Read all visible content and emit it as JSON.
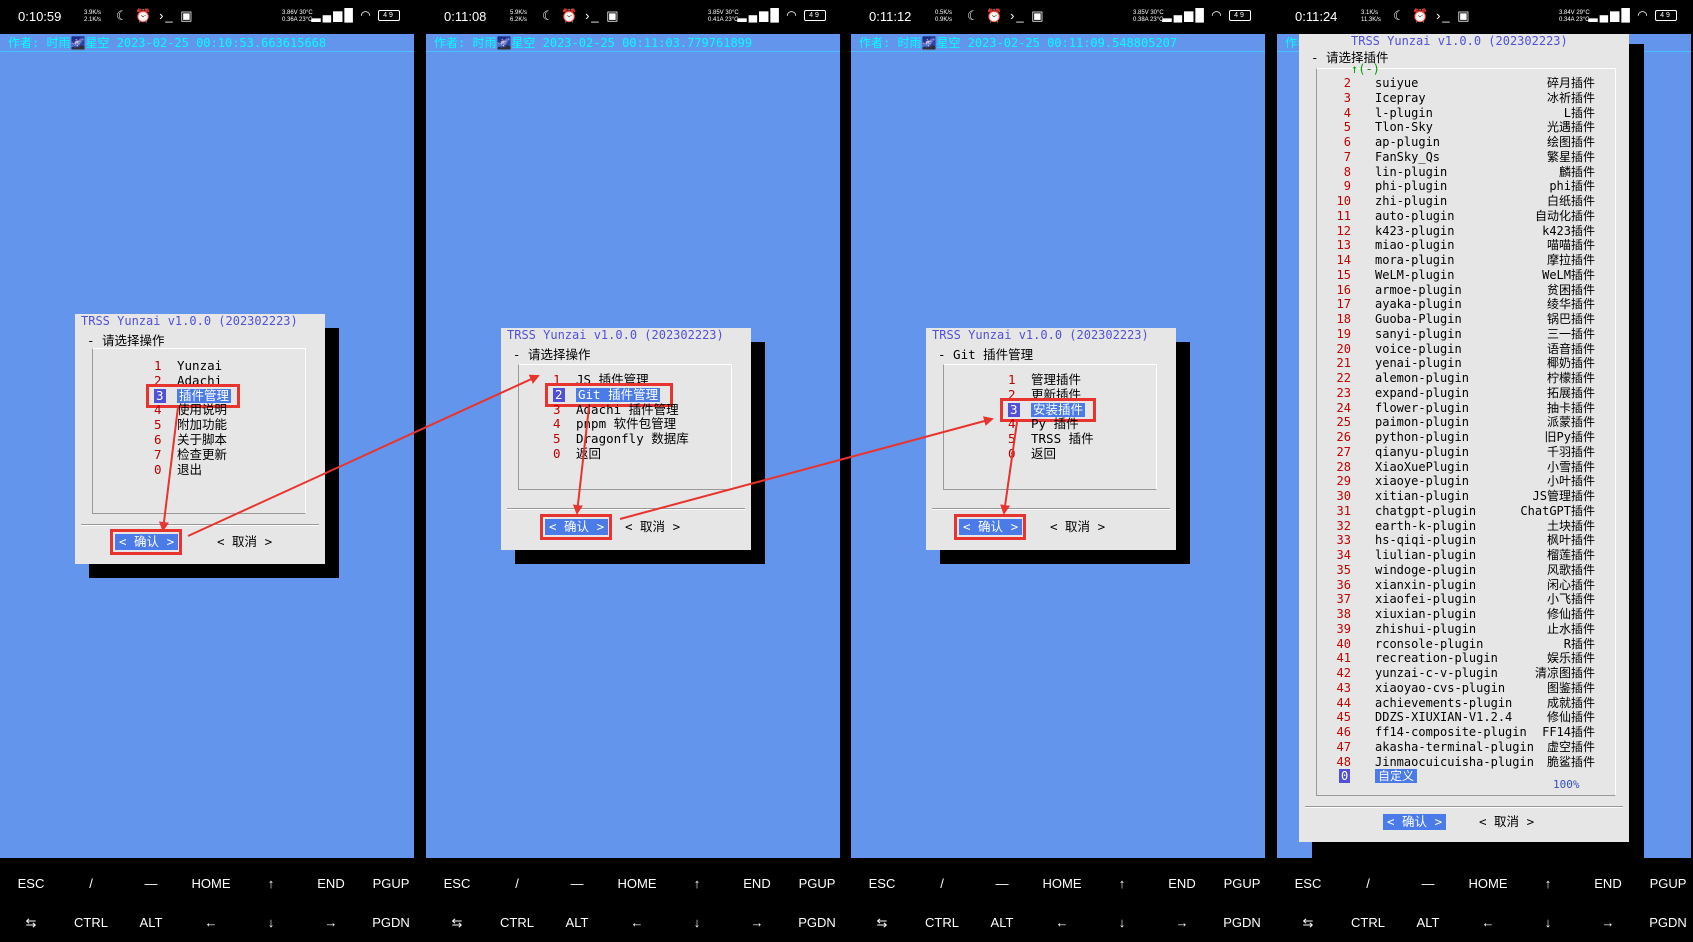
{
  "panels": [
    {
      "status": {
        "time": "0:10:59",
        "speed": "3.9K/s\n2.1K/s",
        "volt": "3.86V 30°C\n0.36A 23°C",
        "battery": "49"
      },
      "header": "作者: 时雨🌌星空 2023-02-25 00:10:53.663615668",
      "dialog_title": "TRSS Yunzai v1.0.0 (202302223)",
      "dialog_subtitle": "- 请选择操作",
      "menu": [
        {
          "num": "1",
          "label": "Yunzai"
        },
        {
          "num": "2",
          "label": "Adachi"
        },
        {
          "num": "3",
          "label": "插件管理"
        },
        {
          "num": "4",
          "label": "使用说明"
        },
        {
          "num": "5",
          "label": "附加功能"
        },
        {
          "num": "6",
          "label": "关于脚本"
        },
        {
          "num": "7",
          "label": "检查更新"
        },
        {
          "num": "0",
          "label": "退出"
        }
      ],
      "ok": "< 确认 >",
      "cancel": "< 取消 >"
    },
    {
      "status": {
        "time": "0:11:08",
        "speed": "5.9K/s\n6.2K/s",
        "volt": "3.85V 30°C\n0.41A 23°C",
        "battery": "49"
      },
      "header": "作者: 时雨🌌星空 2023-02-25 00:11:03.779761899",
      "dialog_title": "TRSS Yunzai v1.0.0 (202302223)",
      "dialog_subtitle": "- 请选择操作",
      "menu": [
        {
          "num": "1",
          "label": "JS 插件管理"
        },
        {
          "num": "2",
          "label": "Git 插件管理"
        },
        {
          "num": "3",
          "label": "Adachi 插件管理"
        },
        {
          "num": "4",
          "label": "pnpm 软件包管理"
        },
        {
          "num": "5",
          "label": "Dragonfly 数据库"
        },
        {
          "num": "0",
          "label": "返回"
        }
      ],
      "ok": "< 确认 >",
      "cancel": "< 取消 >"
    },
    {
      "status": {
        "time": "0:11:12",
        "speed": "0.5K/s\n0.9K/s",
        "volt": "3.85V 30°C\n0.38A 23°C",
        "battery": "49"
      },
      "header": "作者: 时雨🌌星空 2023-02-25 00:11:09.548805207",
      "dialog_title": "TRSS Yunzai v1.0.0 (202302223)",
      "dialog_subtitle": "- Git 插件管理",
      "menu": [
        {
          "num": "1",
          "label": "管理插件"
        },
        {
          "num": "2",
          "label": "更新插件"
        },
        {
          "num": "3",
          "label": "安装插件"
        },
        {
          "num": "4",
          "label": "Py 插件"
        },
        {
          "num": "5",
          "label": "TRSS 插件"
        },
        {
          "num": "0",
          "label": "返回"
        }
      ],
      "ok": "< 确认 >",
      "cancel": "< 取消 >"
    },
    {
      "status": {
        "time": "0:11:24",
        "speed": "3.1K/s\n11.3K/s",
        "volt": "3.84V 29°C\n0.34A 23°C",
        "battery": "49"
      },
      "header": "作者",
      "dialog_title": "TRSS Yunzai v1.0.0 (202302223)",
      "dialog_subtitle": "- 请选择插件",
      "scroll_indicator": "↑(-)",
      "plugins": [
        {
          "num": "2",
          "name": "suiyue",
          "desc": "碎月插件"
        },
        {
          "num": "3",
          "name": "Icepray",
          "desc": "冰祈插件"
        },
        {
          "num": "4",
          "name": "l-plugin",
          "desc": "L插件"
        },
        {
          "num": "5",
          "name": "Tlon-Sky",
          "desc": "光遇插件"
        },
        {
          "num": "6",
          "name": "ap-plugin",
          "desc": "绘图插件"
        },
        {
          "num": "7",
          "name": "FanSky_Qs",
          "desc": "繁星插件"
        },
        {
          "num": "8",
          "name": "lin-plugin",
          "desc": "麟插件"
        },
        {
          "num": "9",
          "name": "phi-plugin",
          "desc": "phi插件"
        },
        {
          "num": "10",
          "name": "zhi-plugin",
          "desc": "白纸插件"
        },
        {
          "num": "11",
          "name": "auto-plugin",
          "desc": "自动化插件"
        },
        {
          "num": "12",
          "name": "k423-plugin",
          "desc": "k423插件"
        },
        {
          "num": "13",
          "name": "miao-plugin",
          "desc": "喵喵插件"
        },
        {
          "num": "14",
          "name": "mora-plugin",
          "desc": "摩拉插件"
        },
        {
          "num": "15",
          "name": "WeLM-plugin",
          "desc": "WeLM插件"
        },
        {
          "num": "16",
          "name": "armoe-plugin",
          "desc": "贫困插件"
        },
        {
          "num": "17",
          "name": "ayaka-plugin",
          "desc": "绫华插件"
        },
        {
          "num": "18",
          "name": "Guoba-Plugin",
          "desc": "锅巴插件"
        },
        {
          "num": "19",
          "name": "sanyi-plugin",
          "desc": "三一插件"
        },
        {
          "num": "20",
          "name": "voice-plugin",
          "desc": "语音插件"
        },
        {
          "num": "21",
          "name": "yenai-plugin",
          "desc": "椰奶插件"
        },
        {
          "num": "22",
          "name": "alemon-plugin",
          "desc": "柠檬插件"
        },
        {
          "num": "23",
          "name": "expand-plugin",
          "desc": "拓展插件"
        },
        {
          "num": "24",
          "name": "flower-plugin",
          "desc": "抽卡插件"
        },
        {
          "num": "25",
          "name": "paimon-plugin",
          "desc": "派蒙插件"
        },
        {
          "num": "26",
          "name": "python-plugin",
          "desc": "旧Py插件"
        },
        {
          "num": "27",
          "name": "qianyu-plugin",
          "desc": "千羽插件"
        },
        {
          "num": "28",
          "name": "XiaoXuePlugin",
          "desc": "小雪插件"
        },
        {
          "num": "29",
          "name": "xiaoye-plugin",
          "desc": "小叶插件"
        },
        {
          "num": "30",
          "name": "xitian-plugin",
          "desc": "JS管理插件"
        },
        {
          "num": "31",
          "name": "chatgpt-plugin",
          "desc": "ChatGPT插件"
        },
        {
          "num": "32",
          "name": "earth-k-plugin",
          "desc": "土块插件"
        },
        {
          "num": "33",
          "name": "hs-qiqi-plugin",
          "desc": "枫叶插件"
        },
        {
          "num": "34",
          "name": "liulian-plugin",
          "desc": "榴莲插件"
        },
        {
          "num": "35",
          "name": "windoge-plugin",
          "desc": "风歌插件"
        },
        {
          "num": "36",
          "name": "xianxin-plugin",
          "desc": "闲心插件"
        },
        {
          "num": "37",
          "name": "xiaofei-plugin",
          "desc": "小飞插件"
        },
        {
          "num": "38",
          "name": "xiuxian-plugin",
          "desc": "修仙插件"
        },
        {
          "num": "39",
          "name": "zhishui-plugin",
          "desc": "止水插件"
        },
        {
          "num": "40",
          "name": "rconsole-plugin",
          "desc": "R插件"
        },
        {
          "num": "41",
          "name": "recreation-plugin",
          "desc": "娱乐插件"
        },
        {
          "num": "42",
          "name": "yunzai-c-v-plugin",
          "desc": "清凉图插件"
        },
        {
          "num": "43",
          "name": "xiaoyao-cvs-plugin",
          "desc": "图鉴插件"
        },
        {
          "num": "44",
          "name": "achievements-plugin",
          "desc": "成就插件"
        },
        {
          "num": "45",
          "name": "DDZS-XIUXIAN-V1.2.4",
          "desc": "修仙插件"
        },
        {
          "num": "46",
          "name": "ff14-composite-plugin",
          "desc": "FF14插件"
        },
        {
          "num": "47",
          "name": "akasha-terminal-plugin",
          "desc": "虚空插件"
        },
        {
          "num": "48",
          "name": "Jinmaocuicuisha-plugin",
          "desc": "脆鲨插件"
        }
      ],
      "custom": {
        "num": "0",
        "label": "自定义"
      },
      "percent": "100%",
      "ok": "< 确认 >",
      "cancel": "< 取消 >"
    }
  ],
  "keys_row1": [
    "ESC",
    "/",
    "—",
    "HOME",
    "↑",
    "END",
    "PGUP"
  ],
  "keys_row2": [
    "⇆",
    "CTRL",
    "ALT",
    "←",
    "↓",
    "→",
    "PGDN"
  ],
  "colors": {
    "terminal_bg": "#6495ED",
    "dialog_bg": "#e6e6e6",
    "highlight": "#e8342e",
    "header_text": "#00FFFF"
  }
}
